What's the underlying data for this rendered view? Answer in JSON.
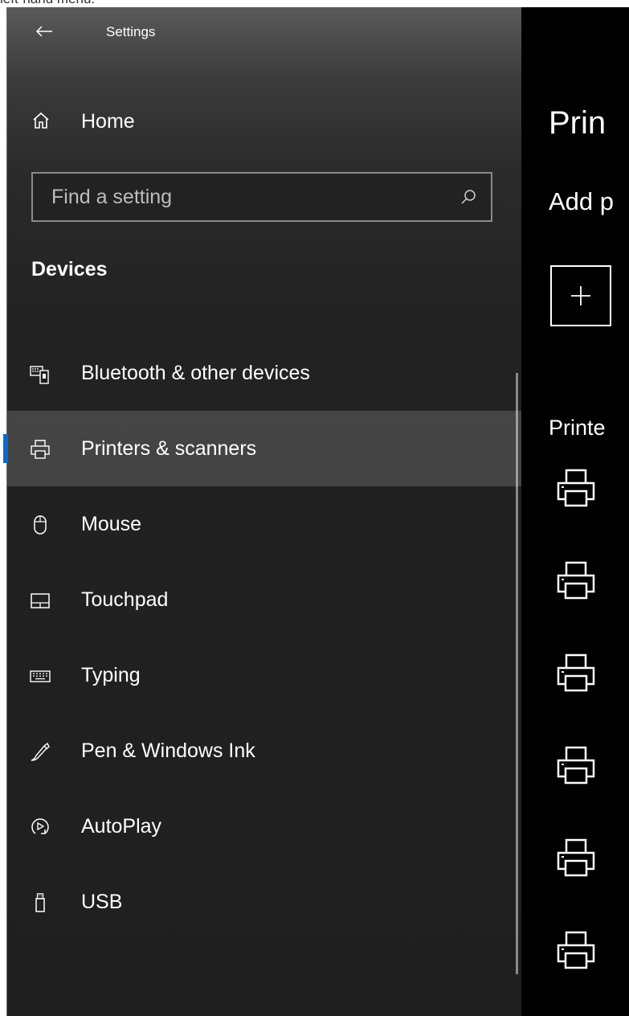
{
  "caption": "left-hand menu.",
  "window": {
    "title": "Settings",
    "back_icon": "back-arrow-icon"
  },
  "sidebar": {
    "home_label": "Home",
    "search_placeholder": "Find a setting",
    "section_title": "Devices",
    "items": [
      {
        "label": "Bluetooth & other devices",
        "icon": "bluetooth-devices-icon",
        "selected": false
      },
      {
        "label": "Printers & scanners",
        "icon": "printer-icon",
        "selected": true
      },
      {
        "label": "Mouse",
        "icon": "mouse-icon",
        "selected": false
      },
      {
        "label": "Touchpad",
        "icon": "touchpad-icon",
        "selected": false
      },
      {
        "label": "Typing",
        "icon": "keyboard-icon",
        "selected": false
      },
      {
        "label": "Pen & Windows Ink",
        "icon": "pen-icon",
        "selected": false
      },
      {
        "label": "AutoPlay",
        "icon": "autoplay-icon",
        "selected": false
      },
      {
        "label": "USB",
        "icon": "usb-icon",
        "selected": false
      }
    ]
  },
  "main": {
    "title": "Prin",
    "add_heading": "Add p",
    "add_button_symbol": "+",
    "printers_heading": "Printe",
    "printer_count": 6
  },
  "colors": {
    "accent": "#0b6bcb",
    "sidebar_bg": "#1f1f1f",
    "content_bg": "#000000"
  }
}
